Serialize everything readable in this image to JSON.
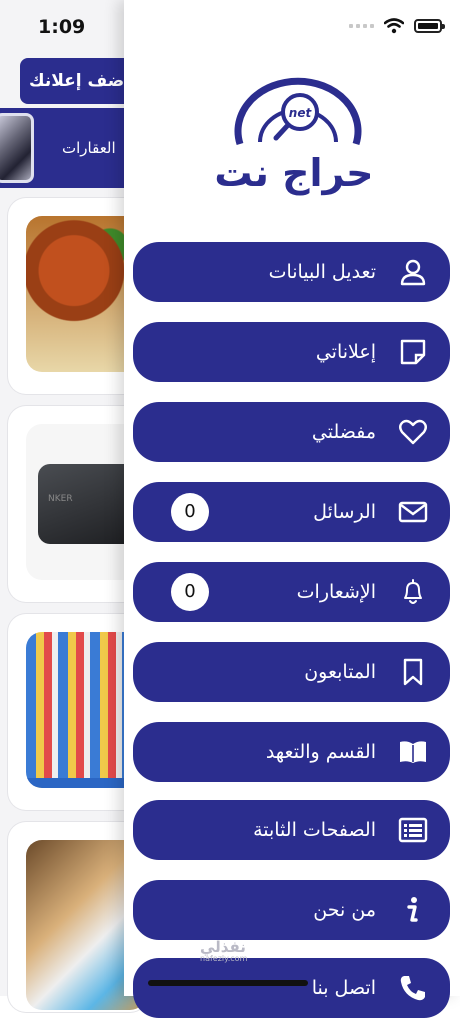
{
  "status_bar": {
    "time": "1:09"
  },
  "background": {
    "add_ad_button": "أضف إعلانك",
    "category_label": "العقارات"
  },
  "drawer": {
    "logo_text": "حراج نت",
    "logo_badge": "net",
    "menu": [
      {
        "label": "تعديل البيانات",
        "icon": "user-icon"
      },
      {
        "label": "إعلاناتي",
        "icon": "note-icon"
      },
      {
        "label": "مفضلتي",
        "icon": "heart-icon"
      },
      {
        "label": "الرسائل",
        "icon": "envelope-icon",
        "count": "0"
      },
      {
        "label": "الإشعارات",
        "icon": "bell-icon",
        "count": "0"
      },
      {
        "label": "المتابعون",
        "icon": "bookmark-icon"
      },
      {
        "label": "القسم والتعهد",
        "icon": "book-icon"
      },
      {
        "label": "الصفحات الثابتة",
        "icon": "list-icon"
      },
      {
        "label": "من نحن",
        "icon": "info-icon"
      },
      {
        "label": "اتصل بنا",
        "icon": "phone-icon"
      }
    ]
  },
  "watermark": {
    "arabic": "نفذلي",
    "latin": "nafezly.com"
  },
  "colors": {
    "primary": "#2b2d8e",
    "background": "#f4f4f6"
  }
}
